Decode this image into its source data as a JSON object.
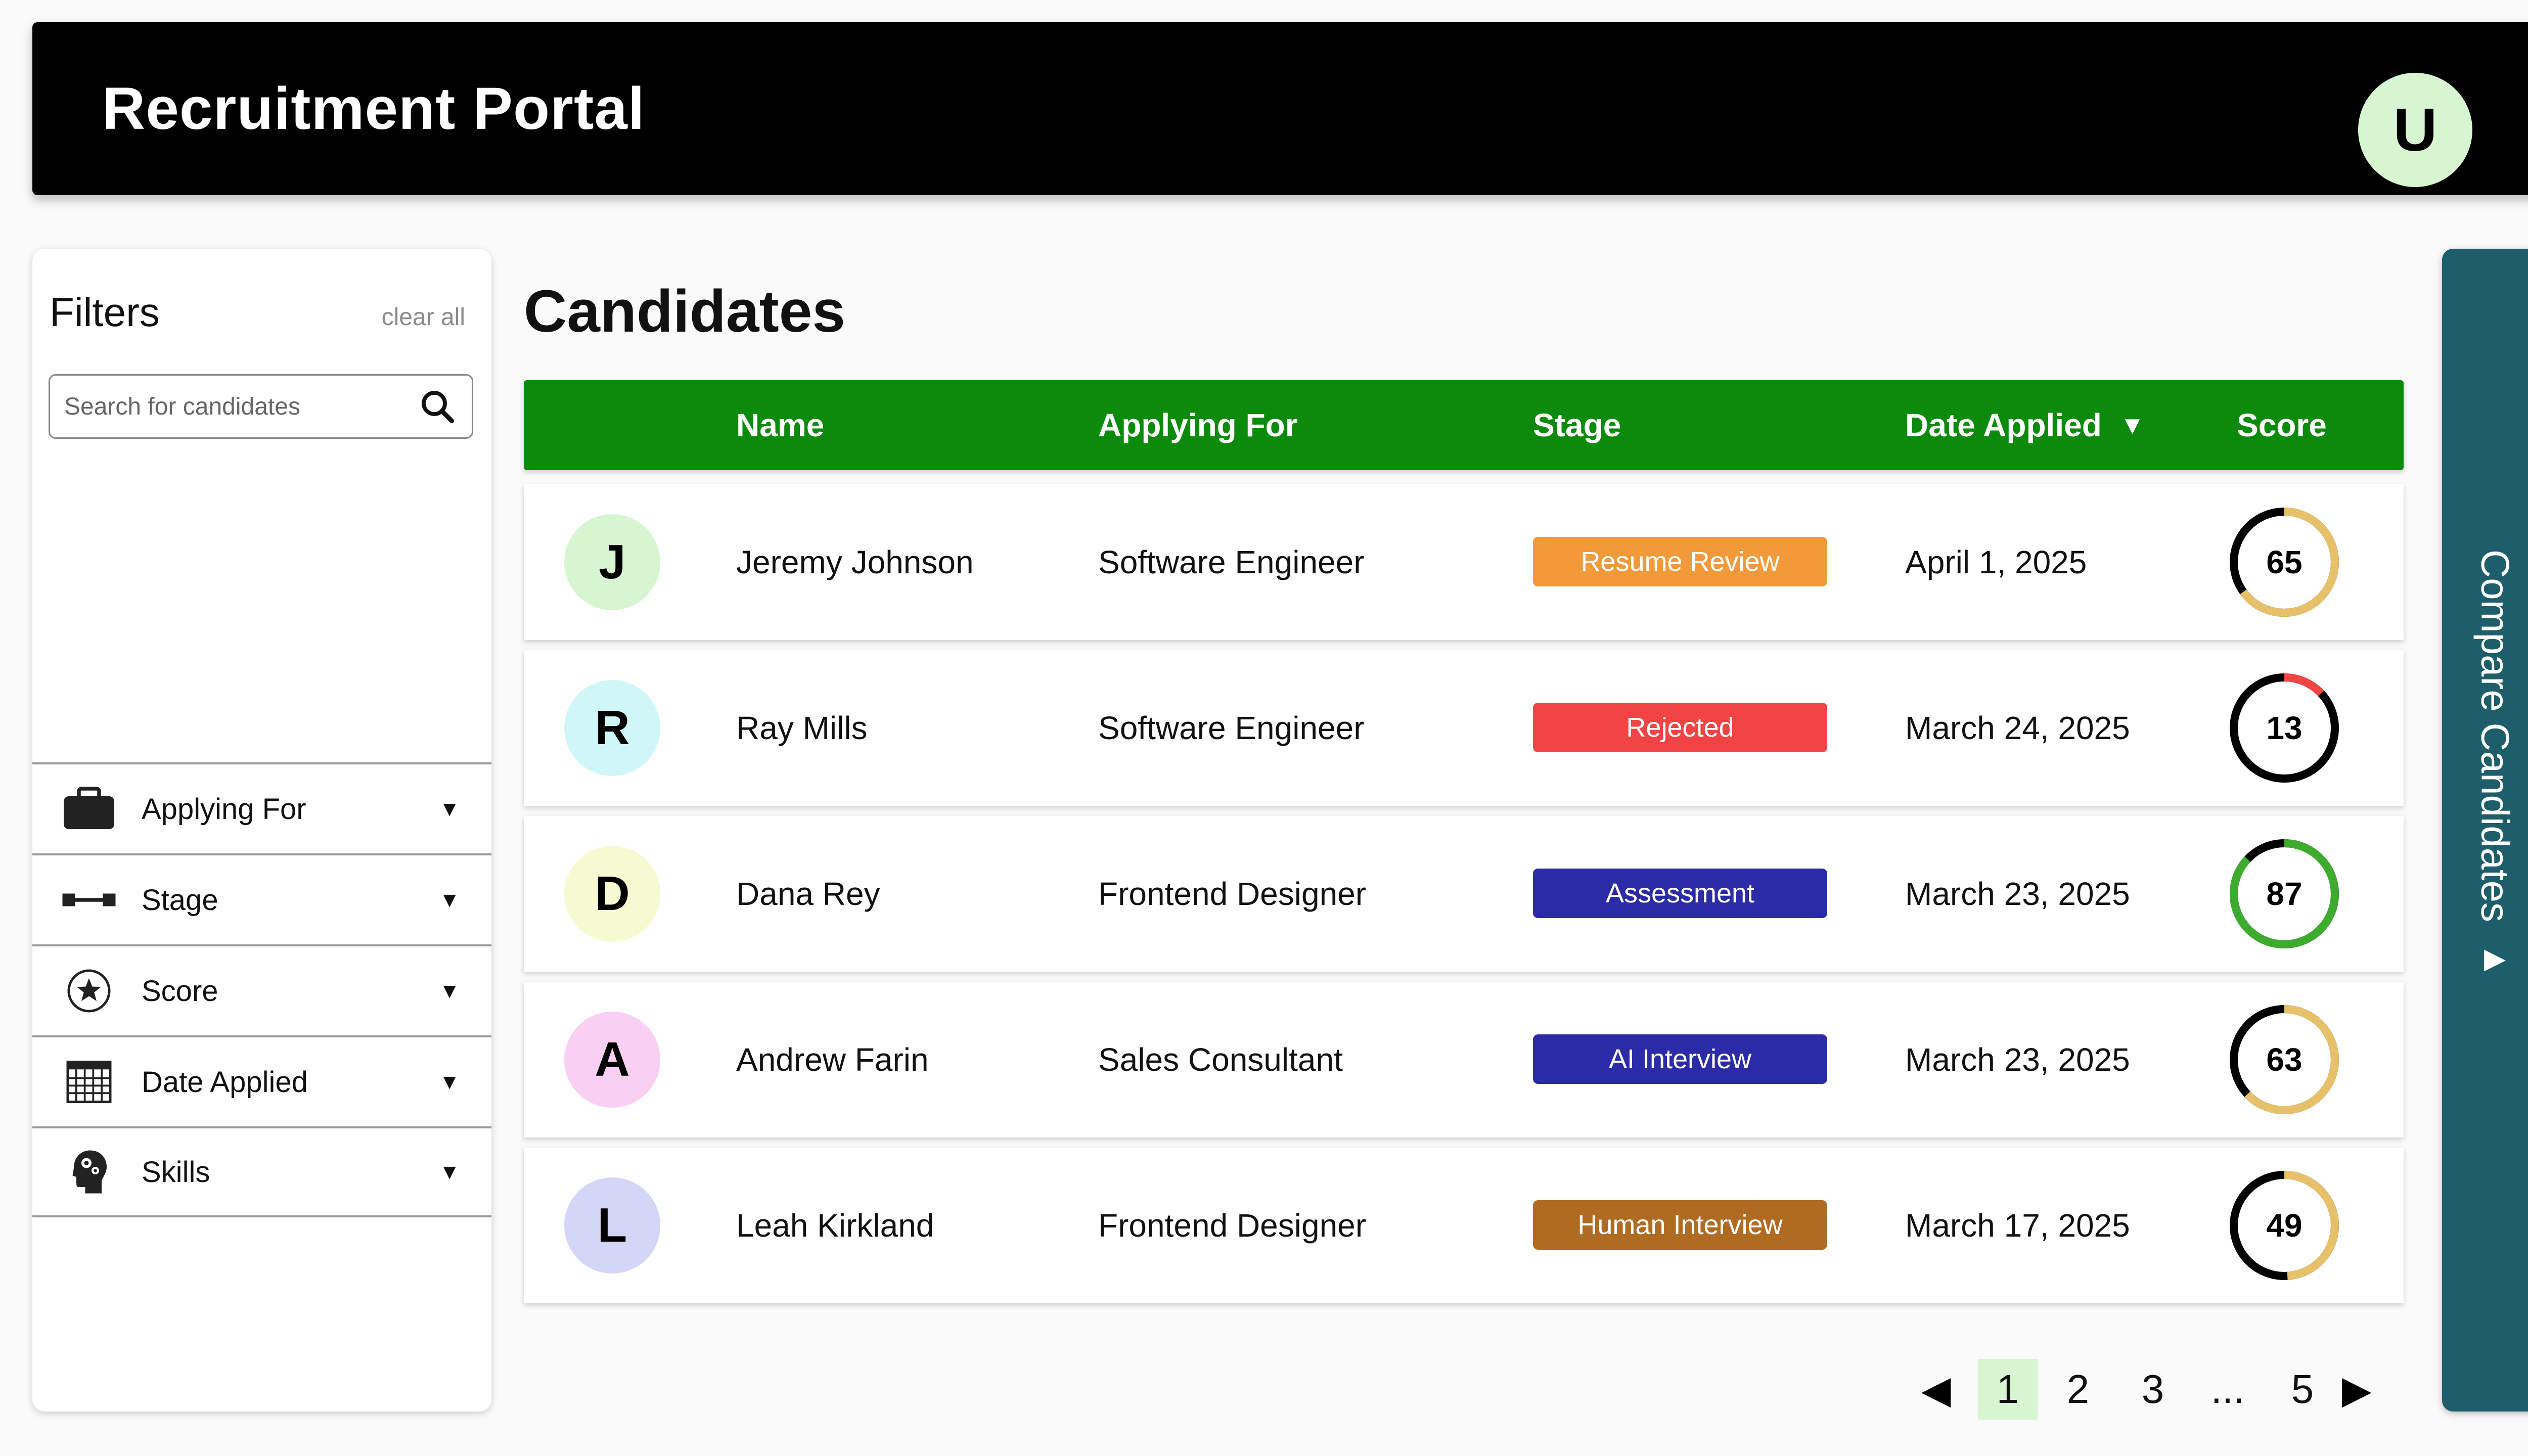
{
  "header": {
    "title": "Recruitment Portal",
    "user_initial": "U"
  },
  "sidebar": {
    "title": "Filters",
    "clear_all": "clear all",
    "search_placeholder": "Search for candidates",
    "filters": [
      {
        "label": "Applying For",
        "icon": "briefcase-icon"
      },
      {
        "label": "Stage",
        "icon": "stage-pipeline-icon"
      },
      {
        "label": "Score",
        "icon": "star-circle-icon"
      },
      {
        "label": "Date Applied",
        "icon": "calendar-icon"
      },
      {
        "label": "Skills",
        "icon": "head-gears-icon"
      }
    ]
  },
  "main": {
    "title": "Candidates",
    "columns": {
      "name": "Name",
      "applying_for": "Applying For",
      "stage": "Stage",
      "date_applied": "Date Applied",
      "score": "Score"
    },
    "sort": {
      "column": "Date Applied",
      "direction": "descending"
    },
    "candidates": [
      {
        "initial": "J",
        "name": "Jeremy Johnson",
        "applying_for": "Software Engineer",
        "stage": "Resume Review",
        "date": "April 1, 2025",
        "score": "65",
        "avatar_color": "#d6f5d0",
        "stage_color": "#f29a3a",
        "ring_color": "#e6c16a"
      },
      {
        "initial": "R",
        "name": "Ray Mills",
        "applying_for": "Software Engineer",
        "stage": "Rejected",
        "date": "March 24, 2025",
        "score": "13",
        "avatar_color": "#d0f7f8",
        "stage_color": "#f24444",
        "ring_color": "#f24444"
      },
      {
        "initial": "D",
        "name": "Dana Rey",
        "applying_for": "Frontend Designer",
        "stage": "Assessment",
        "date": "March 23, 2025",
        "score": "87",
        "avatar_color": "#f6fad0",
        "stage_color": "#2b2ba8",
        "ring_color": "#3cab2e"
      },
      {
        "initial": "A",
        "name": "Andrew Farin",
        "applying_for": "Sales Consultant",
        "stage": "AI Interview",
        "date": "March 23, 2025",
        "score": "63",
        "avatar_color": "#f9d0f4",
        "stage_color": "#2b2ba8",
        "ring_color": "#e6c16a"
      },
      {
        "initial": "L",
        "name": "Leah Kirkland",
        "applying_for": "Frontend Designer",
        "stage": "Human Interview",
        "date": "March 17, 2025",
        "score": "49",
        "avatar_color": "#d3d6f6",
        "stage_color": "#b06b22",
        "ring_color": "#e6c16a"
      }
    ]
  },
  "pagination": {
    "pages": [
      "1",
      "2",
      "3",
      "...",
      "5"
    ],
    "current": "1"
  },
  "compare": {
    "label": "Compare Candidates"
  }
}
